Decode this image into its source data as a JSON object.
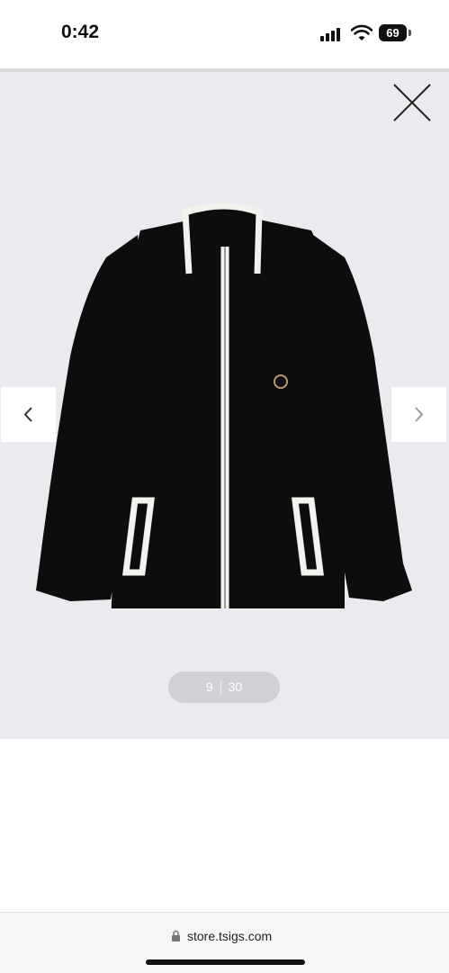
{
  "status_bar": {
    "time": "0:42",
    "battery_level": "69",
    "icons": [
      "signal-icon",
      "wifi-icon",
      "battery-icon"
    ]
  },
  "gallery": {
    "current_index": "9",
    "total": "30",
    "image_name": "black-zip-up-knit-jacket",
    "icons": [
      "close-icon",
      "chevron-left-icon",
      "chevron-right-icon"
    ]
  },
  "browser": {
    "url": "store.tsigs.com"
  },
  "colors": {
    "gallery_bg": "#ebeaee",
    "jacket": "#0d0d0d",
    "trim": "#f4f2ee"
  }
}
